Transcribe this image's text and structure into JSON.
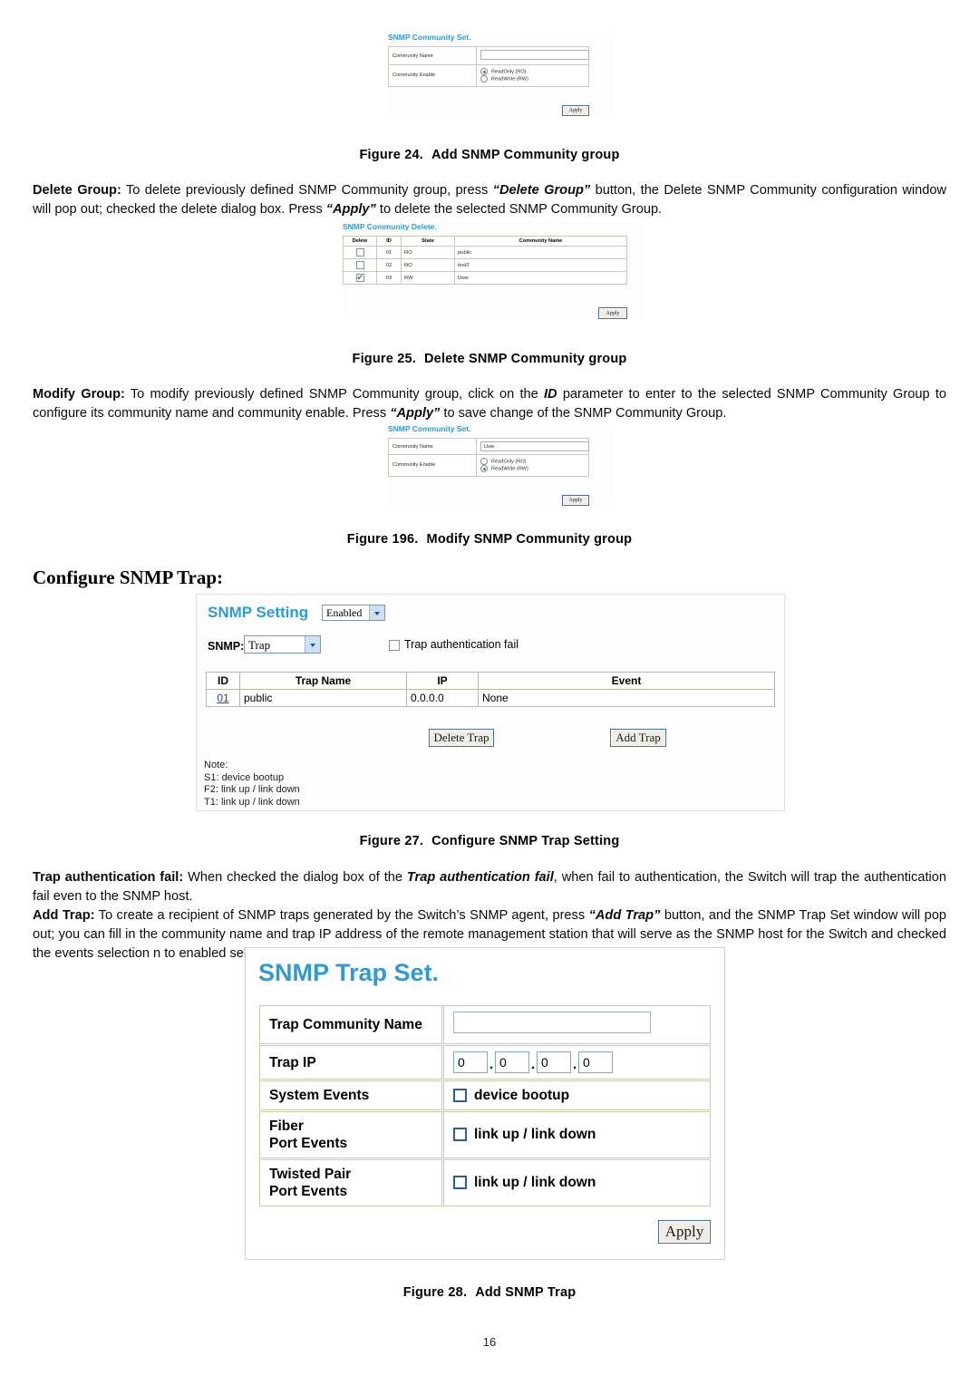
{
  "page": {
    "number": "16"
  },
  "figure24": {
    "shot": {
      "title": "SNMP Community Set.",
      "rows": [
        {
          "label": "Community Name",
          "value": ""
        },
        {
          "label": "Community Enable"
        }
      ],
      "radios": [
        {
          "label": "ReadOnly (RO)",
          "selected": true
        },
        {
          "label": "ReadWrite (RW)",
          "selected": false
        }
      ],
      "apply_label": "Apply"
    },
    "caption_number": "Figure 24.",
    "caption_text": "Add SNMP Community group"
  },
  "delete_group_para": {
    "lead": "Delete Group:",
    "t1": " To delete previously defined SNMP Community group, press ",
    "em1": "“Delete Group”",
    "t2": " button, the Delete SNMP Community configuration window will pop out; checked the delete dialog box. Press ",
    "em2": "“Apply”",
    "t3": " to delete the selected SNMP Community Group."
  },
  "figure25": {
    "shot": {
      "title": "SNMP Community Delete.",
      "columns": [
        "Delete",
        "ID",
        "State",
        "Community Name"
      ],
      "rows": [
        {
          "checked": false,
          "id": "01",
          "state": "RO",
          "name": "public"
        },
        {
          "checked": false,
          "id": "02",
          "state": "RO",
          "name": "test2"
        },
        {
          "checked": true,
          "id": "03",
          "state": "RW",
          "name": "User"
        }
      ],
      "apply_label": "Apply"
    },
    "caption_number": "Figure 25.",
    "caption_text": "Delete SNMP Community group"
  },
  "modify_group_para": {
    "lead": "Modify Group:",
    "t1": " To modify previously defined SNMP Community group, click on the ",
    "em1": "ID",
    "t2": " parameter to enter to the selected SNMP Community Group to configure its community name and community enable. Press ",
    "em2": "“Apply”",
    "t3": " to save change of the SNMP Community Group."
  },
  "figure196": {
    "shot": {
      "title": "SNMP Community Set.",
      "rows": [
        {
          "label": "Community Name",
          "value": "Usw"
        },
        {
          "label": "Community Enable"
        }
      ],
      "radios": [
        {
          "label": "ReadOnly (RO)",
          "selected": false
        },
        {
          "label": "ReadWrite (RW)",
          "selected": true
        }
      ],
      "apply_label": "Apply"
    },
    "caption_number": "Figure 196.",
    "caption_text": "Modify SNMP Community group"
  },
  "section_heading": "Configure SNMP Trap:",
  "figure27": {
    "shot": {
      "title": "SNMP Setting",
      "enabled_select": "Enabled",
      "snmp_label": "SNMP:",
      "snmp_select": "Trap",
      "trap_auth_label": "Trap authentication fail",
      "trap_auth_checked": false,
      "columns": [
        "ID",
        "Trap Name",
        "IP",
        "Event"
      ],
      "rows": [
        {
          "id": "01",
          "name": "public",
          "ip": "0.0.0.0",
          "event": "None"
        }
      ],
      "delete_trap_label": "Delete Trap",
      "add_trap_label": "Add Trap",
      "note_title": "Note:",
      "notes": [
        "S1: device bootup",
        "F2: link up / link down",
        "T1: link up / link down"
      ]
    },
    "caption_number": "Figure 27.",
    "caption_text": "Configure SNMP Trap Setting"
  },
  "trap_auth_para": {
    "lead": "Trap authentication fail:",
    "t1": " When checked the dialog box of the ",
    "em1": "Trap authentication fail",
    "t2": ", when fail to authentication, the Switch will trap the authentication fail even to the SNMP host."
  },
  "add_trap_para": {
    "lead": "Add Trap:",
    "t1": " To create a recipient of SNMP traps generated by the Switch’s SNMP agent, press ",
    "em1": "“Add Trap”",
    "t2": " button, and the SNMP Trap Set window will pop out; you can fill in the community name and trap IP address of the remote management station that will serve as the SNMP host for the Switch and checked the events selection n to enabled selected event traps."
  },
  "figure28": {
    "shot": {
      "title": "SNMP Trap Set.",
      "rows": [
        {
          "label": "Trap Community Name",
          "type": "text",
          "value": ""
        },
        {
          "label": "Trap IP",
          "type": "ip",
          "octets": [
            "0",
            "0",
            "0",
            "0"
          ]
        },
        {
          "label": "System Events",
          "type": "check",
          "event_label": "device bootup",
          "checked": false
        },
        {
          "label": "Fiber\nPort Events",
          "label_line1": "Fiber",
          "label_line2": "Port Events",
          "type": "check",
          "event_label": "link up / link down",
          "checked": false
        },
        {
          "label": "Twisted Pair\nPort Events",
          "label_line1": "Twisted Pair",
          "label_line2": "Port Events",
          "type": "check",
          "event_label": "link up / link down",
          "checked": false
        }
      ],
      "apply_label": "Apply"
    },
    "caption_number": "Figure 28.",
    "caption_text": "Add SNMP Trap"
  },
  "colors": {
    "panel_heading": "#2e9bd6",
    "table_border": "#cdc8b0",
    "input_border": "#9db3d6",
    "link": "#2b3fa0"
  }
}
